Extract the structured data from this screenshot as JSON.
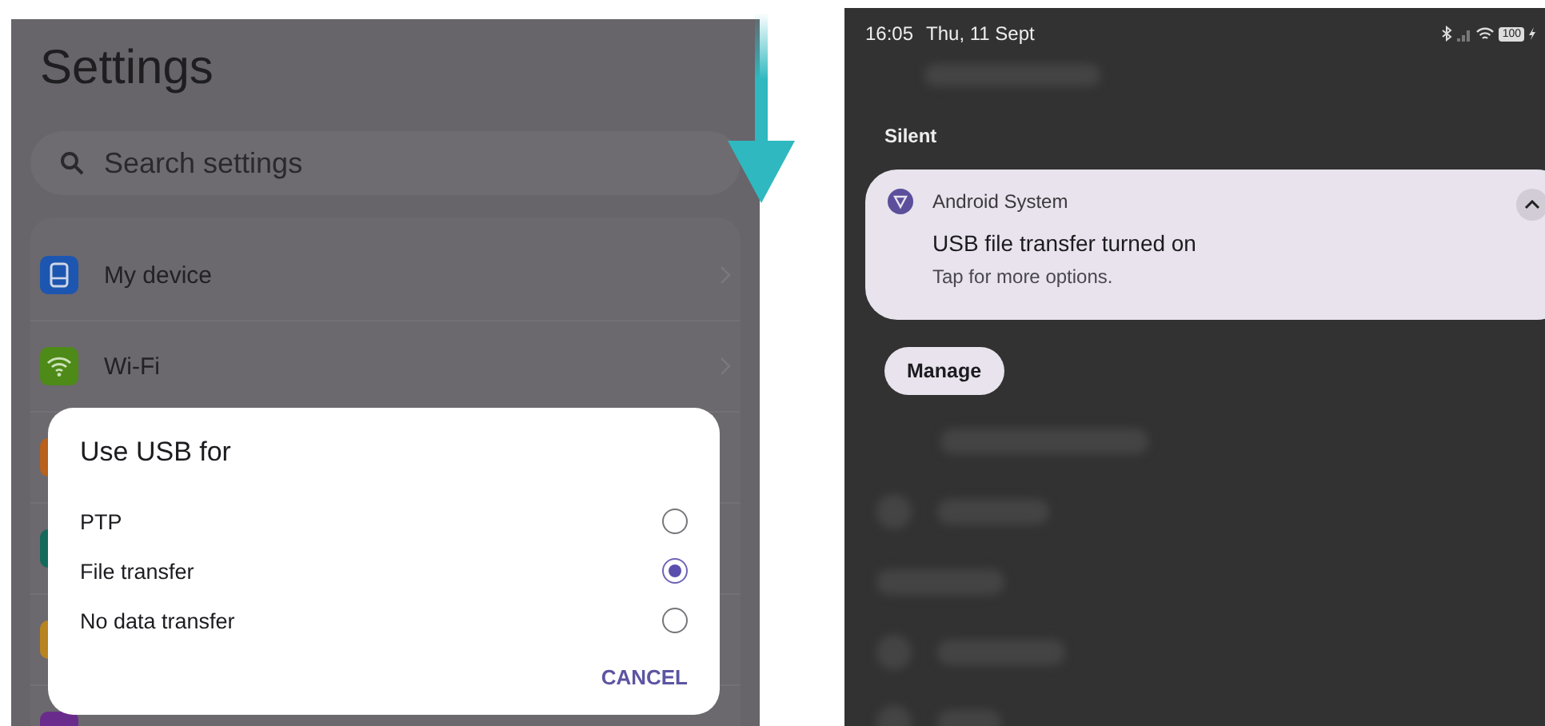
{
  "settings_screen": {
    "title": "Settings",
    "search": {
      "placeholder": "Search settings"
    },
    "items": [
      {
        "label": "My device",
        "color": "#1d56b0"
      },
      {
        "label": "Wi-Fi",
        "color": "#4d8a18"
      },
      {
        "color": "#b8601c"
      },
      {
        "color": "#136a5c"
      },
      {
        "color": "#b88420"
      },
      {
        "color": "#6a2c8c"
      }
    ],
    "dialog": {
      "title": "Use USB for",
      "options": [
        {
          "label": "PTP",
          "selected": false
        },
        {
          "label": "File transfer",
          "selected": true
        },
        {
          "label": "No data transfer",
          "selected": false
        }
      ],
      "cancel": "CANCEL"
    }
  },
  "notification_shade": {
    "status_bar": {
      "time": "16:05",
      "date": "Thu, 11 Sept",
      "battery": "100"
    },
    "section": "Silent",
    "notification": {
      "app": "Android System",
      "title": "USB file transfer turned on",
      "text": "Tap for more options.",
      "expanded": true
    },
    "manage": "Manage"
  }
}
